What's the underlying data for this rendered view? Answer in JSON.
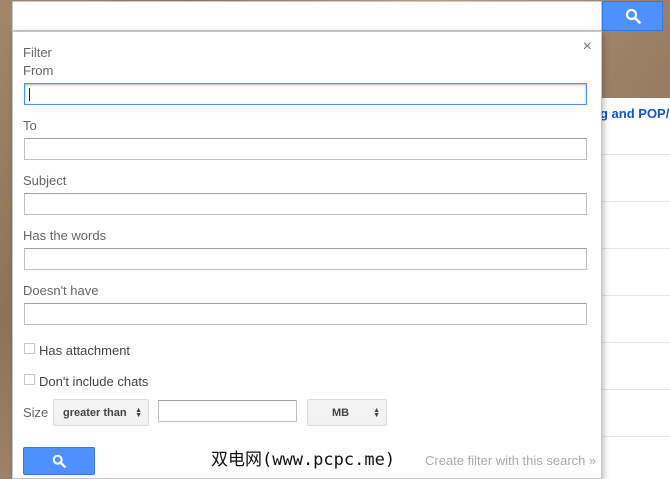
{
  "filter_dialog": {
    "title": "Filter",
    "close_glyph": "×",
    "fields": {
      "from_label": "From",
      "to_label": "To",
      "subject_label": "Subject",
      "has_words_label": "Has the words",
      "doesnt_have_label": "Doesn't have"
    },
    "has_attachment_label": "Has attachment",
    "dont_include_chats_label": "Don't include chats",
    "size_label": "Size",
    "size_operator": "greater than",
    "size_unit": "MB",
    "create_filter_link": "Create filter with this search »"
  },
  "background_panel": {
    "link_text": "g and POP/I"
  },
  "watermark": "双电网(www.pcpc.me)",
  "icons": {
    "search": "search-icon",
    "close": "close-icon"
  },
  "colors": {
    "accent": "#4d90fe",
    "link": "#1155cc"
  }
}
